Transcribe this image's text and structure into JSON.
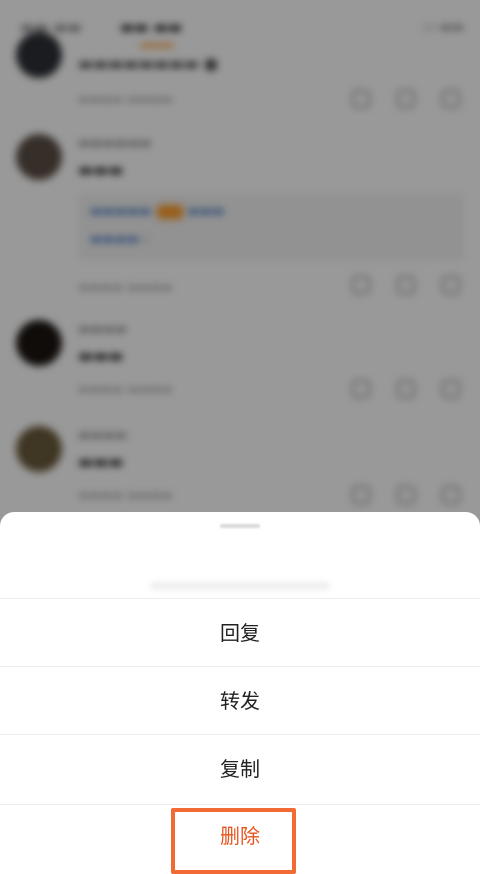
{
  "action_sheet": {
    "items": [
      {
        "label": "回复"
      },
      {
        "label": "转发"
      },
      {
        "label": "复制"
      },
      {
        "label": "删除"
      }
    ]
  },
  "colors": {
    "danger": "#e8541e",
    "highlight_frame": "#f26b35",
    "accent": "#ff8200"
  }
}
